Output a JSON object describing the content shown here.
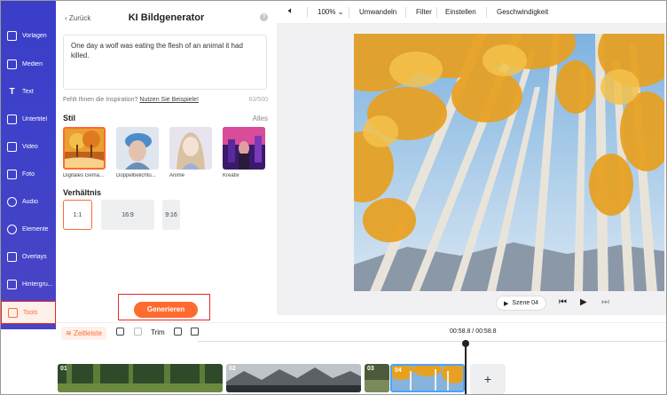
{
  "sidebar": {
    "items": [
      {
        "label": "Vorlagen",
        "icon": "templates-icon"
      },
      {
        "label": "Medien",
        "icon": "media-icon"
      },
      {
        "label": "Text",
        "icon": "text-icon"
      },
      {
        "label": "Untertitel",
        "icon": "subtitles-icon"
      },
      {
        "label": "Video",
        "icon": "video-icon"
      },
      {
        "label": "Foto",
        "icon": "photo-icon"
      },
      {
        "label": "Audio",
        "icon": "audio-icon"
      },
      {
        "label": "Elemente",
        "icon": "elements-icon"
      },
      {
        "label": "Overlays",
        "icon": "overlays-icon"
      },
      {
        "label": "Hintergru...",
        "icon": "background-icon"
      },
      {
        "label": "Tools",
        "icon": "tools-icon",
        "active": true
      }
    ]
  },
  "panel": {
    "back_label": "Zurück",
    "title": "KI Bildgenerator",
    "prompt_text": "One day a wolf was eating the flesh of an animal it had killed.",
    "inspiration_text": "Fehlt Ihnen die Inspiration?",
    "inspiration_link": "Nutzen Sie Beispiele!",
    "char_count": "63/500",
    "style_heading": "Stil",
    "all_label": "Alles",
    "styles": [
      {
        "caption": "Digitales Gemä...",
        "selected": true
      },
      {
        "caption": "Doppelbelichtu..."
      },
      {
        "caption": "Anime"
      },
      {
        "caption": "Kreativ"
      }
    ],
    "ratio_heading": "Verhältnis",
    "ratios": [
      "1:1",
      "16:9",
      "9:16"
    ],
    "selected_ratio": "1:1",
    "generate_label": "Generieren"
  },
  "toolbar": {
    "zoom": "100%",
    "convert": "Umwandeln",
    "filter": "Filter",
    "settings": "Einstellen",
    "speed": "Geschwindigkeit"
  },
  "player": {
    "scene_label": "Szene 04"
  },
  "timeline": {
    "tab_label": "Zeitleiste",
    "trim_label": "Trim",
    "time": "00:58.8 / 00:58.8",
    "clips": [
      "01",
      "02",
      "03",
      "04"
    ],
    "add_label": "+"
  },
  "colors": {
    "accent": "#ff6a2f",
    "sidebar": "#3f42c9",
    "highlight_box": "#e02a2a"
  }
}
